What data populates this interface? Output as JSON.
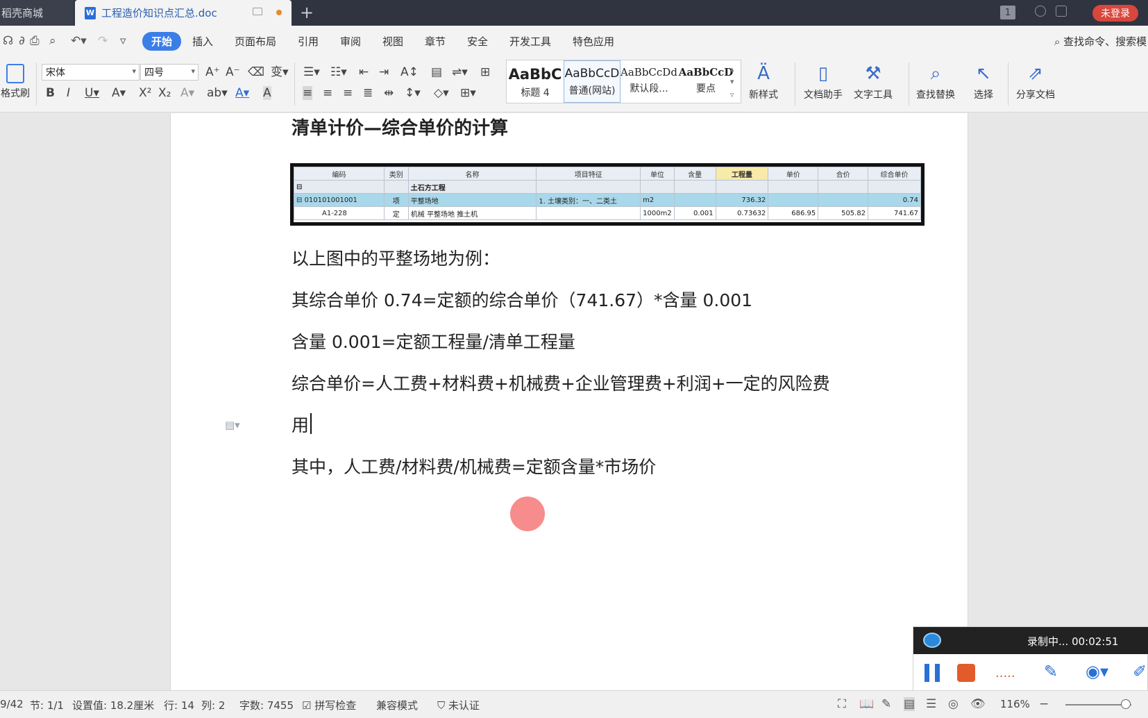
{
  "titlebar": {
    "tabs": [
      {
        "label": "稻壳商城"
      },
      {
        "label": "工程造价知识点汇总.doc"
      }
    ],
    "page_badge": "1",
    "login": "未登录"
  },
  "menubar": {
    "items": [
      "开始",
      "插入",
      "页面布局",
      "引用",
      "审阅",
      "视图",
      "章节",
      "安全",
      "开发工具",
      "特色应用"
    ],
    "search": "查找命令、搜索模"
  },
  "ribbon": {
    "format_painter": "格式刷",
    "font": "宋体",
    "size": "四号",
    "styles": [
      {
        "sample": "AaBbC",
        "name": "标题 4"
      },
      {
        "sample": "AaBbCcD",
        "name": "普通(网站)"
      },
      {
        "sample": "AaBbCcDd",
        "name": "默认段..."
      },
      {
        "sample": "AaBbCcD",
        "name": "要点"
      }
    ],
    "buttons": [
      "新样式",
      "文档助手",
      "文字工具",
      "查找替换",
      "选择",
      "分享文档"
    ]
  },
  "document": {
    "heading": "清单计价—综合单价的计算",
    "table": {
      "headers": [
        "编码",
        "类别",
        "名称",
        "项目特征",
        "单位",
        "含量",
        "工程量",
        "单价",
        "合价",
        "综合单价"
      ],
      "rows": [
        [
          "",
          "",
          "土石方工程",
          "",
          "",
          "",
          "",
          "",
          "",
          ""
        ],
        [
          "010101001001",
          "项",
          "平整场地",
          "1. 土壤类别：一、二类土",
          "m2",
          "",
          "736.32",
          "",
          "",
          "0.74"
        ],
        [
          "A1-228",
          "定",
          "机械 平整场地 推土机",
          "",
          "1000m2",
          "0.001",
          "0.73632",
          "686.95",
          "505.82",
          "741.67"
        ]
      ]
    },
    "paragraphs": [
      "以上图中的平整场地为例：",
      "其综合单价 0.74=定额的综合单价（741.67）*含量 0.001",
      "含量 0.001=定额工程量/清单工程量",
      "综合单价=人工费+材料费+机械费+企业管理费+利润+一定的风险费",
      "用",
      "其中，人工费/材料费/机械费=定额含量*市场价"
    ]
  },
  "recording": {
    "status": "录制中... 00:02:51"
  },
  "statusbar": {
    "page": "9/42",
    "section": "节: 1/1",
    "setting": "设置值: 18.2厘米",
    "line": "行: 14",
    "column": "列: 2",
    "words": "字数: 7455",
    "spellcheck": "拼写检查",
    "compat": "兼容模式",
    "cert": "未认证",
    "zoom": "116%"
  }
}
